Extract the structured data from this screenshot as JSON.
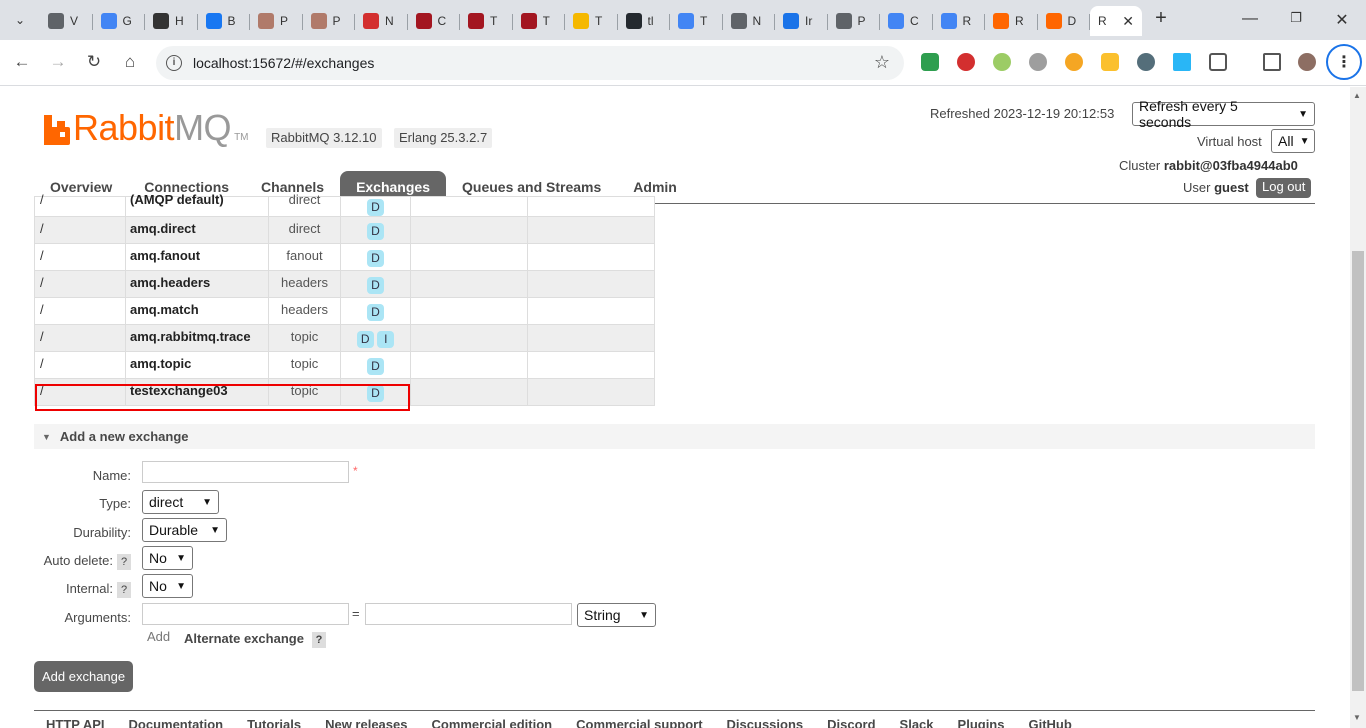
{
  "browser": {
    "tabs": [
      {
        "title": "V",
        "color": "#5f6368"
      },
      {
        "title": "G",
        "color": "#4285f4"
      },
      {
        "title": "H",
        "color": "#333333"
      },
      {
        "title": "B",
        "color": "#1877f2"
      },
      {
        "title": "P",
        "color": "#b07a6a"
      },
      {
        "title": "P",
        "color": "#b07a6a"
      },
      {
        "title": "N",
        "color": "#d32f2f"
      },
      {
        "title": "C",
        "color": "#a31621"
      },
      {
        "title": "T",
        "color": "#a31621"
      },
      {
        "title": "T",
        "color": "#a31621"
      },
      {
        "title": "T",
        "color": "#f5b800"
      },
      {
        "title": "tl",
        "color": "#24292f"
      },
      {
        "title": "T",
        "color": "#4285f4"
      },
      {
        "title": "N",
        "color": "#5f6368"
      },
      {
        "title": "Ir",
        "color": "#1a73e8"
      },
      {
        "title": "P",
        "color": "#5f6368"
      },
      {
        "title": "C",
        "color": "#4285f4"
      },
      {
        "title": "R",
        "color": "#4285f4"
      },
      {
        "title": "R",
        "color": "#ff6600"
      },
      {
        "title": "D",
        "color": "#ff6600"
      }
    ],
    "active_tab_title": "R",
    "url": "localhost:15672/#/exchanges"
  },
  "header": {
    "logo_rabbit": "Rabbit",
    "logo_mq": "MQ",
    "logo_tm": "TM",
    "version": "RabbitMQ 3.12.10",
    "erlang": "Erlang 25.3.2.7",
    "refreshed": "Refreshed 2023-12-19 20:12:53",
    "refresh_option": "Refresh every 5 seconds",
    "vhost_label": "Virtual host",
    "vhost_value": "All",
    "cluster_label": "Cluster",
    "cluster_name": "rabbit@03fba4944ab0",
    "user_label": "User",
    "user_name": "guest",
    "logout": "Log out"
  },
  "nav": [
    {
      "label": "Overview",
      "active": false
    },
    {
      "label": "Connections",
      "active": false
    },
    {
      "label": "Channels",
      "active": false
    },
    {
      "label": "Exchanges",
      "active": true
    },
    {
      "label": "Queues and Streams",
      "active": false
    },
    {
      "label": "Admin",
      "active": false
    }
  ],
  "exchanges": [
    {
      "vhost": "/",
      "name": "(AMQP default)",
      "type": "direct",
      "features": [
        "D"
      ]
    },
    {
      "vhost": "/",
      "name": "amq.direct",
      "type": "direct",
      "features": [
        "D"
      ]
    },
    {
      "vhost": "/",
      "name": "amq.fanout",
      "type": "fanout",
      "features": [
        "D"
      ]
    },
    {
      "vhost": "/",
      "name": "amq.headers",
      "type": "headers",
      "features": [
        "D"
      ]
    },
    {
      "vhost": "/",
      "name": "amq.match",
      "type": "headers",
      "features": [
        "D"
      ]
    },
    {
      "vhost": "/",
      "name": "amq.rabbitmq.trace",
      "type": "topic",
      "features": [
        "D",
        "I"
      ]
    },
    {
      "vhost": "/",
      "name": "amq.topic",
      "type": "topic",
      "features": [
        "D"
      ]
    },
    {
      "vhost": "/",
      "name": "testexchange03",
      "type": "topic",
      "features": [
        "D"
      ]
    }
  ],
  "add_exchange": {
    "title": "Add a new exchange",
    "name_label": "Name:",
    "name_value": "",
    "required_mark": "*",
    "type_label": "Type:",
    "type_value": "direct",
    "durability_label": "Durability:",
    "durability_value": "Durable",
    "auto_delete_label": "Auto delete:",
    "auto_delete_value": "No",
    "internal_label": "Internal:",
    "internal_value": "No",
    "arguments_label": "Arguments:",
    "arg_key": "",
    "arg_equals": "=",
    "arg_value": "",
    "arg_type": "String",
    "add_link": "Add",
    "alternate_exchange": "Alternate exchange",
    "help": "?",
    "submit": "Add exchange"
  },
  "footer": [
    "HTTP API",
    "Documentation",
    "Tutorials",
    "New releases",
    "Commercial edition",
    "Commercial support",
    "Discussions",
    "Discord",
    "Slack",
    "Plugins",
    "GitHub"
  ]
}
